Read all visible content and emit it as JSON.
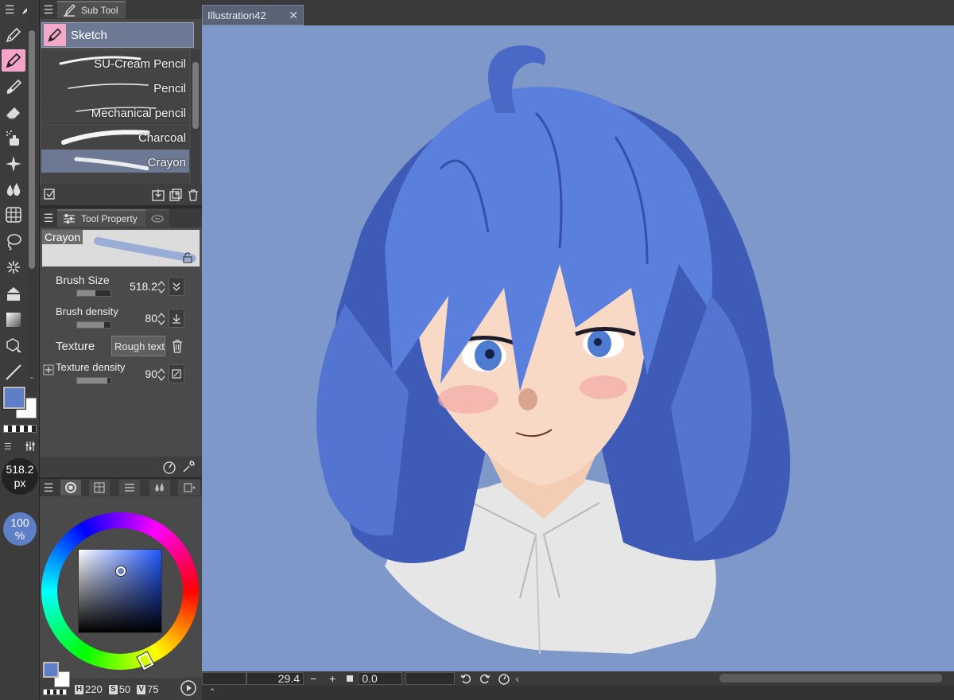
{
  "toolbox": {
    "tools": [
      {
        "name": "pen-tool",
        "active": false
      },
      {
        "name": "pencil-tool",
        "active": true
      },
      {
        "name": "brush-tool",
        "active": false
      },
      {
        "name": "eraser-tool",
        "active": false
      },
      {
        "name": "airbrush-tool",
        "active": false
      },
      {
        "name": "decoration-tool",
        "active": false
      },
      {
        "name": "blend-tool",
        "active": false
      },
      {
        "name": "operation-tool",
        "active": false
      },
      {
        "name": "lasso-selection-tool",
        "active": false
      },
      {
        "name": "auto-select-tool",
        "active": false
      },
      {
        "name": "fill-tool",
        "active": false
      },
      {
        "name": "gradient-tool",
        "active": false
      },
      {
        "name": "move-layer-tool",
        "active": false
      },
      {
        "name": "line-tool",
        "active": false
      }
    ],
    "main_color": "#5e7fc8",
    "sub_color": "#ffffff",
    "brush_size_value": "518.2",
    "brush_size_unit": "px",
    "opacity_value": "100",
    "opacity_unit": "%"
  },
  "subtool_panel": {
    "tab_label": "Sub Tool",
    "group_label": "Sketch",
    "brushes": [
      {
        "label": "SU-Cream Pencil",
        "selected": false
      },
      {
        "label": "Pencil",
        "selected": false
      },
      {
        "label": "Mechanical pencil",
        "selected": false
      },
      {
        "label": "Charcoal",
        "selected": false
      },
      {
        "label": "Crayon",
        "selected": true
      }
    ]
  },
  "tool_property": {
    "tab_label": "Tool Property",
    "preview_name": "Crayon",
    "brush_size": {
      "label": "Brush Size",
      "value": "518.2",
      "fraction": 0.55
    },
    "brush_density": {
      "label": "Brush density",
      "value": "80",
      "fraction": 0.8
    },
    "texture": {
      "label": "Texture",
      "value": "Rough texture"
    },
    "texture_density": {
      "label": "Texture density",
      "value": "90",
      "fraction": 0.9
    }
  },
  "color_panel": {
    "hue_label": "H",
    "hue": "220",
    "sat_label": "S",
    "sat": "50",
    "val_label": "V",
    "val": "75"
  },
  "document": {
    "tab_title": "Illustration42",
    "close_glyph": "✕",
    "canvas_bg": "#7d98c9"
  },
  "statusbar": {
    "zoom": "29.4",
    "zoom_out": "−",
    "zoom_in": "+",
    "angle": "0.0"
  }
}
